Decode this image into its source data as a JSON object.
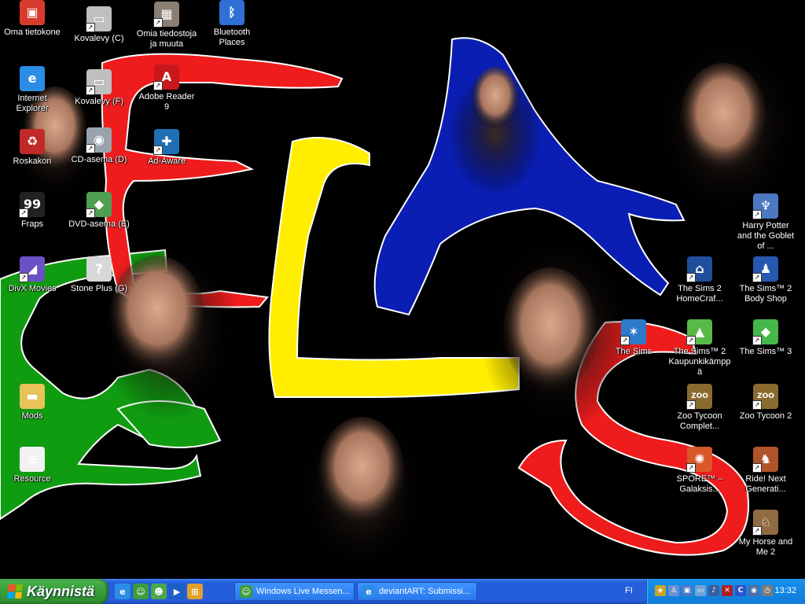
{
  "desktop_icons": [
    {
      "name": "icon-oma-tietokone",
      "label": "Oma tietokone",
      "icon": "computer-icon",
      "glyph": "▣",
      "color": "#d93a2e",
      "shortcut": false
    },
    {
      "name": "icon-kovalevy-c",
      "label": "Kovalevy (C)",
      "icon": "hard-drive-icon",
      "glyph": "▭",
      "color": "#bfbfbf",
      "shortcut": true
    },
    {
      "name": "icon-omia-tiedostoja",
      "label": "Omia tiedostoja ja muuta",
      "icon": "folder-photo-icon",
      "glyph": "▦",
      "color": "#8a7f72",
      "shortcut": true
    },
    {
      "name": "icon-bluetooth-places",
      "label": "Bluetooth Places",
      "icon": "bluetooth-icon",
      "glyph": "ᛒ",
      "color": "#2f6fd6",
      "shortcut": false
    },
    {
      "name": "icon-internet-explorer",
      "label": "Internet Explorer",
      "icon": "internet-explorer-icon",
      "glyph": "e",
      "color": "#2b8de6",
      "shortcut": false
    },
    {
      "name": "icon-kovalevy-f",
      "label": "Kovalevy (F)",
      "icon": "hard-drive-icon",
      "glyph": "▭",
      "color": "#bfbfbf",
      "shortcut": true
    },
    {
      "name": "icon-adobe-reader",
      "label": "Adobe Reader 9",
      "icon": "adobe-reader-icon",
      "glyph": "A",
      "color": "#c8181b",
      "shortcut": true
    },
    {
      "name": "icon-roskakori",
      "label": "Roskakori",
      "icon": "recycle-bin-icon",
      "glyph": "♻",
      "color": "#c22a2a",
      "shortcut": false
    },
    {
      "name": "icon-cd-asema",
      "label": "CD-asema (D)",
      "icon": "cd-drive-icon",
      "glyph": "◉",
      "color": "#9aa3ad",
      "shortcut": true
    },
    {
      "name": "icon-ad-aware",
      "label": "Ad-Aware",
      "icon": "ad-aware-icon",
      "glyph": "✚",
      "color": "#1e6fb4",
      "shortcut": true
    },
    {
      "name": "icon-fraps",
      "label": "Fraps",
      "icon": "fraps-icon",
      "glyph": "99",
      "color": "#222222",
      "shortcut": true
    },
    {
      "name": "icon-dvd-asema",
      "label": "DVD-asema (E)",
      "icon": "dvd-drive-icon",
      "glyph": "◆",
      "color": "#4f9e52",
      "shortcut": true
    },
    {
      "name": "icon-divx-movies",
      "label": "DivX Movies",
      "icon": "divx-icon",
      "glyph": "◢",
      "color": "#6a52c6",
      "shortcut": true
    },
    {
      "name": "icon-stone-plus",
      "label": "Stone Plus (G)",
      "icon": "removable-drive-icon",
      "glyph": "?",
      "color": "#d8d8d8",
      "shortcut": false
    },
    {
      "name": "icon-mods",
      "label": "Mods",
      "icon": "folder-icon",
      "glyph": "▬",
      "color": "#e8c35a",
      "shortcut": false
    },
    {
      "name": "icon-resource",
      "label": "Resource",
      "icon": "document-icon",
      "glyph": "≡",
      "color": "#f2f2f2",
      "shortcut": false
    },
    {
      "name": "icon-harry-potter",
      "label": "Harry Potter and the Goblet of ...",
      "icon": "harry-potter-game-icon",
      "glyph": "♆",
      "color": "#4c78c2",
      "shortcut": true
    },
    {
      "name": "icon-sims2-homecraft",
      "label": "The Sims 2 HomeCraf...",
      "icon": "sims-homecraft-icon",
      "glyph": "⌂",
      "color": "#1f4f9a",
      "shortcut": true
    },
    {
      "name": "icon-sims2-bodyshop",
      "label": "The Sims™ 2 Body Shop",
      "icon": "sims-bodyshop-icon",
      "glyph": "♟",
      "color": "#2758b0",
      "shortcut": true
    },
    {
      "name": "icon-the-sims",
      "label": "The Sims",
      "icon": "the-sims-icon",
      "glyph": "✶",
      "color": "#2f79c9",
      "shortcut": true
    },
    {
      "name": "icon-sims2-kaupunki",
      "label": "The Sims™ 2 Kaupunkikämppä",
      "icon": "sims-apartment-icon",
      "glyph": "▲",
      "color": "#59b947",
      "shortcut": true
    },
    {
      "name": "icon-sims3",
      "label": "The Sims™ 3",
      "icon": "sims3-plumbob-icon",
      "glyph": "◆",
      "color": "#46b84a",
      "shortcut": true
    },
    {
      "name": "icon-zoo-tycoon-complete",
      "label": "Zoo Tycoon Complet...",
      "icon": "zoo-tycoon-icon",
      "glyph": "ZOO",
      "color": "#8a6a2e",
      "shortcut": true
    },
    {
      "name": "icon-zoo-tycoon-2",
      "label": "Zoo Tycoon 2",
      "icon": "zoo-tycoon-2-icon",
      "glyph": "ZOO",
      "color": "#8a6a2e",
      "shortcut": true
    },
    {
      "name": "icon-spore",
      "label": "SPORE™ – Galaksis...",
      "icon": "spore-icon",
      "glyph": "✺",
      "color": "#d9582a",
      "shortcut": true
    },
    {
      "name": "icon-ride-next-generation",
      "label": "Ride! Next Generati...",
      "icon": "horse-game-icon",
      "glyph": "♞",
      "color": "#b0542a",
      "shortcut": true
    },
    {
      "name": "icon-my-horse-and-me",
      "label": "My Horse and Me 2",
      "icon": "horse-head-icon",
      "glyph": "♘",
      "color": "#8f6a43",
      "shortcut": true
    }
  ],
  "taskbar": {
    "start_label": "Käynnistä",
    "quick_launch": [
      {
        "name": "quicklaunch-ie",
        "icon": "internet-explorer-icon",
        "glyph": "e",
        "color": "#2b8de6"
      },
      {
        "name": "quicklaunch-messenger",
        "icon": "messenger-people-icon",
        "glyph": "☺",
        "color": "#3c9b3c"
      },
      {
        "name": "quicklaunch-messenger-2",
        "icon": "messenger-icon",
        "glyph": "☻",
        "color": "#4aa84a"
      },
      {
        "name": "quicklaunch-media-player",
        "icon": "media-player-icon",
        "glyph": "▶",
        "color": "#1d5fc4"
      },
      {
        "name": "quicklaunch-show-desktop",
        "icon": "windows-flag-icon",
        "glyph": "⊞",
        "color": "#e0a12a"
      }
    ],
    "tasks": [
      {
        "name": "task-windows-live-messenger",
        "label": "Windows Live Messen...",
        "icon": "messenger-icon",
        "glyph": "☺",
        "color": "#3c9b3c"
      },
      {
        "name": "task-deviantart",
        "label": "deviantART: Submissi...",
        "icon": "internet-explorer-icon",
        "glyph": "e",
        "color": "#2b8de6"
      }
    ],
    "language": "FI",
    "tray_icons": [
      {
        "name": "tray-icon-1",
        "icon": "shield-tray-icon",
        "glyph": "◈",
        "color": "#c9a227"
      },
      {
        "name": "tray-icon-2",
        "icon": "user-tray-icon",
        "glyph": "♙",
        "color": "#6b8fd1"
      },
      {
        "name": "tray-icon-3",
        "icon": "network-tray-icon",
        "glyph": "▣",
        "color": "#4a7bc7"
      },
      {
        "name": "tray-icon-4",
        "icon": "monitor-tray-icon",
        "glyph": "▭",
        "color": "#6fa3d8"
      },
      {
        "name": "tray-icon-5",
        "icon": "sound-tray-icon",
        "glyph": "♪",
        "color": "#3b5e9e"
      },
      {
        "name": "tray-icon-6",
        "icon": "antivirus-tray-icon",
        "glyph": "✕",
        "color": "#b02020"
      },
      {
        "name": "tray-icon-7",
        "icon": "c-tray-icon",
        "glyph": "C",
        "color": "#2b55c7"
      },
      {
        "name": "tray-icon-8",
        "icon": "eye-tray-icon",
        "glyph": "◉",
        "color": "#4c6fa8"
      },
      {
        "name": "tray-icon-9",
        "icon": "clock-tray-icon",
        "glyph": "◷",
        "color": "#7a7a7a"
      }
    ],
    "clock": "13:32"
  }
}
